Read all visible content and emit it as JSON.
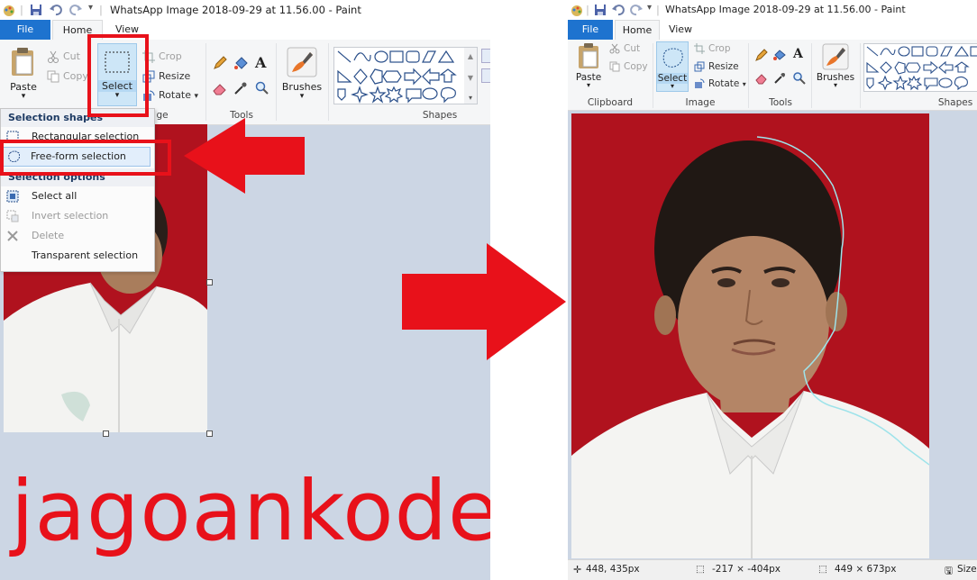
{
  "app": {
    "window_title": "WhatsApp Image 2018-09-29 at 11.56.00 - Paint",
    "colors": {
      "file_tab": "#1e73cf",
      "highlight": "#e8111a",
      "canvas_bg": "#ccd6e4",
      "photo_bg": "#b0121e"
    }
  },
  "tabs": {
    "file": "File",
    "home": "Home",
    "view": "View"
  },
  "ribbon": {
    "paste": "Paste",
    "cut": "Cut",
    "copy": "Copy",
    "select": "Select",
    "crop": "Crop",
    "resize": "Resize",
    "rotate": "Rotate",
    "brushes": "Brushes",
    "groups": {
      "clipboard": "Clipboard",
      "image": "Image",
      "image_partial": "ge",
      "tools": "Tools",
      "shapes": "Shapes"
    }
  },
  "select_menu": {
    "header_shapes": "Selection shapes",
    "rectangular": "Rectangular selection",
    "freeform": "Free-form selection",
    "header_options": "Selection options",
    "select_all": "Select all",
    "invert": "Invert selection",
    "delete": "Delete",
    "transparent": "Transparent selection"
  },
  "status": {
    "cursor": "448, 435px",
    "selection": "-217 × -404px",
    "image_size": "449 × 673px",
    "size_label": "Size:"
  },
  "watermark": "jagoankode",
  "icons": [
    "paint-app-icon",
    "save-icon",
    "undo-icon",
    "redo-icon",
    "paste-icon",
    "cut-icon",
    "copy-icon",
    "select-rect-icon",
    "select-freeform-icon",
    "crop-icon",
    "resize-icon",
    "rotate-icon",
    "pencil-icon",
    "fill-icon",
    "text-icon",
    "eraser-icon",
    "color-picker-icon",
    "magnifier-icon",
    "brushes-icon",
    "shapes-gallery-icon",
    "arrow-left-icon",
    "arrow-right-icon",
    "cursor-position-icon",
    "selection-size-icon",
    "image-size-icon"
  ]
}
